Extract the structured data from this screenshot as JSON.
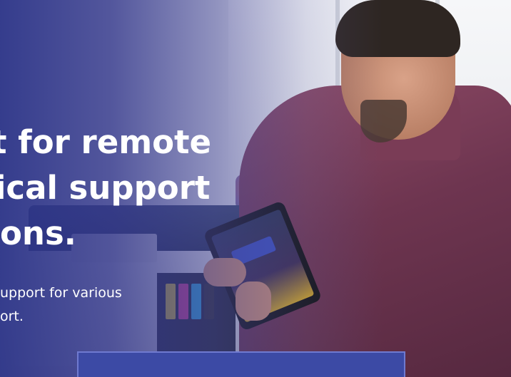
{
  "hero": {
    "headline": {
      "line1": "t for remote",
      "line2": "ical support",
      "line3": "ons."
    },
    "subtext": {
      "line1": "upport for various",
      "line2": "ort."
    },
    "image_alt_icon": "photo-technician-with-tablet-and-printer",
    "overlay_color": "#2c3488",
    "cta_color": "#3c4aa5"
  }
}
